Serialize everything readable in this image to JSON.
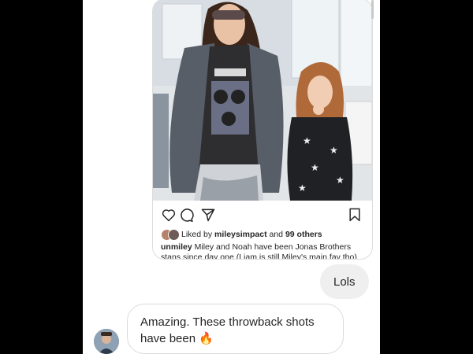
{
  "post": {
    "likes_prefix": "Liked by",
    "likes_user": "mileysimpact",
    "likes_middle": "and",
    "likes_others": "99 others",
    "caption_user": "unmiley",
    "caption_text": "Miley and Noah have been Jonas Brothers stans since day one (Liam is still Miley's main fav tho)"
  },
  "messages": {
    "outgoing": "Lols",
    "incoming_line1": "Amazing. These throwback shots",
    "incoming_line2": "have been",
    "incoming_emoji": "🔥"
  },
  "icons": [
    "heart-icon",
    "comment-icon",
    "share-icon",
    "bookmark-icon",
    "fire-emoji"
  ],
  "colors": {
    "outgoing_bubble": "#efefef",
    "incoming_border": "#dbdbdb",
    "text": "#262626"
  }
}
